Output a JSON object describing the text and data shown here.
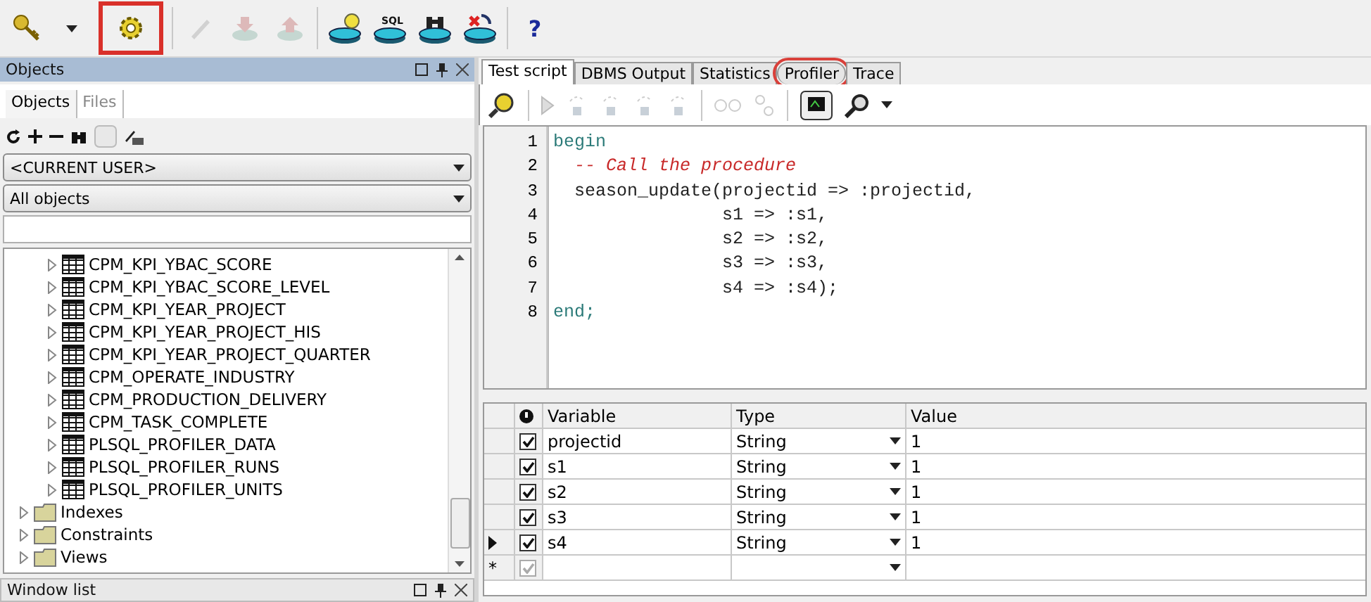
{
  "toolbar": {
    "buttons": [
      {
        "kind": "key",
        "disabled": false
      },
      {
        "kind": "caret",
        "disabled": false
      },
      {
        "kind": "gear",
        "disabled": false,
        "highlighted": true
      },
      {
        "kind": "pen",
        "disabled": true
      },
      {
        "kind": "down",
        "disabled": true
      },
      {
        "kind": "up",
        "disabled": true
      },
      {
        "kind": "bulb",
        "disabled": false
      },
      {
        "kind": "sql",
        "disabled": false
      },
      {
        "kind": "binoculars",
        "disabled": false
      },
      {
        "kind": "cancel",
        "disabled": false
      },
      {
        "kind": "help",
        "disabled": false
      }
    ],
    "sql_label": "SQL",
    "help_label": "?"
  },
  "objects_panel": {
    "title": "Objects",
    "tabs": [
      {
        "label": "Objects",
        "selected": true
      },
      {
        "label": "Files",
        "selected": false
      }
    ],
    "owner": "<CURRENT USER>",
    "filter": "All objects",
    "tree": [
      {
        "label": "CPM_KPI_YBAC_SCORE",
        "kind": "table",
        "expanded": false
      },
      {
        "label": "CPM_KPI_YBAC_SCORE_LEVEL",
        "kind": "table",
        "expanded": false
      },
      {
        "label": "CPM_KPI_YEAR_PROJECT",
        "kind": "table",
        "expanded": false
      },
      {
        "label": "CPM_KPI_YEAR_PROJECT_HIS",
        "kind": "table",
        "expanded": false
      },
      {
        "label": "CPM_KPI_YEAR_PROJECT_QUARTER",
        "kind": "table",
        "expanded": false
      },
      {
        "label": "CPM_OPERATE_INDUSTRY",
        "kind": "table",
        "expanded": false
      },
      {
        "label": "CPM_PRODUCTION_DELIVERY",
        "kind": "table",
        "expanded": false
      },
      {
        "label": "CPM_TASK_COMPLETE",
        "kind": "table",
        "expanded": false
      },
      {
        "label": "PLSQL_PROFILER_DATA",
        "kind": "table",
        "expanded": false
      },
      {
        "label": "PLSQL_PROFILER_RUNS",
        "kind": "table",
        "expanded": false
      },
      {
        "label": "PLSQL_PROFILER_UNITS",
        "kind": "table",
        "expanded": false
      },
      {
        "label": "Indexes",
        "kind": "folder",
        "expanded": false
      },
      {
        "label": "Constraints",
        "kind": "folder",
        "expanded": false
      },
      {
        "label": "Views",
        "kind": "folder",
        "expanded": false
      }
    ]
  },
  "window_list": {
    "title": "Window list"
  },
  "editor_tabs": [
    {
      "label": "Test script",
      "selected": true,
      "circled": false
    },
    {
      "label": "DBMS Output",
      "selected": false,
      "circled": false
    },
    {
      "label": "Statistics",
      "selected": false,
      "circled": false
    },
    {
      "label": "Profiler",
      "selected": false,
      "circled": true
    },
    {
      "label": "Trace",
      "selected": false,
      "circled": false
    }
  ],
  "code": [
    {
      "number": "1",
      "text": "begin",
      "kind": "keyword"
    },
    {
      "number": "2",
      "text": "  -- Call the procedure",
      "kind": "comment"
    },
    {
      "number": "3",
      "text": "  season_update(projectid => :projectid,",
      "kind": "code"
    },
    {
      "number": "4",
      "text": "                s1 => :s1,",
      "kind": "code"
    },
    {
      "number": "5",
      "text": "                s2 => :s2,",
      "kind": "code"
    },
    {
      "number": "6",
      "text": "                s3 => :s3,",
      "kind": "code"
    },
    {
      "number": "7",
      "text": "                s4 => :s4);",
      "kind": "code"
    },
    {
      "number": "8",
      "text": "end;",
      "kind": "keyword"
    }
  ],
  "variables": {
    "columns": [
      "Variable",
      "Type",
      "Value"
    ],
    "rows": [
      {
        "variable": "projectid",
        "type": "String",
        "value": "1",
        "checked": true,
        "selected": false,
        "kind": "row"
      },
      {
        "variable": "s1",
        "type": "String",
        "value": "1",
        "checked": true,
        "selected": false,
        "kind": "row"
      },
      {
        "variable": "s2",
        "type": "String",
        "value": "1",
        "checked": true,
        "selected": false,
        "kind": "row"
      },
      {
        "variable": "s3",
        "type": "String",
        "value": "1",
        "checked": true,
        "selected": false,
        "kind": "row"
      },
      {
        "variable": "s4",
        "type": "String",
        "value": "1",
        "checked": true,
        "selected": true,
        "kind": "row"
      },
      {
        "kind": "new",
        "checked": true,
        "selected": false,
        "marker": "*"
      }
    ]
  }
}
